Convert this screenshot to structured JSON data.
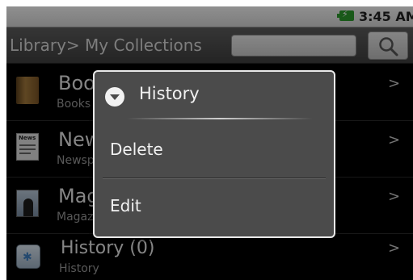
{
  "status_bar": {
    "time": "3:45 AM",
    "battery_icon": "battery-charging-icon"
  },
  "title_bar": {
    "breadcrumb": "Library> My Collections",
    "search_placeholder": "",
    "search_icon": "search-icon"
  },
  "collections": [
    {
      "title": "Boo",
      "subtitle": "Books",
      "icon": "books-icon"
    },
    {
      "title": "New",
      "subtitle": "Newsp",
      "icon": "newspaper-icon"
    },
    {
      "title": "Mag",
      "subtitle": "Magaz",
      "icon": "magazine-icon"
    },
    {
      "title": "History (0)",
      "subtitle": "History",
      "icon": "history-folder-icon"
    }
  ],
  "chevron": ">",
  "news_icon_label": "News",
  "context_menu": {
    "title": "History",
    "items": [
      {
        "label": "Delete"
      },
      {
        "label": "Edit"
      }
    ]
  },
  "colors": {
    "dialog_bg": "#4b4b4b",
    "dialog_border": "#e9e9e9",
    "list_bg": "#000000",
    "battery": "#2c9a2c"
  }
}
